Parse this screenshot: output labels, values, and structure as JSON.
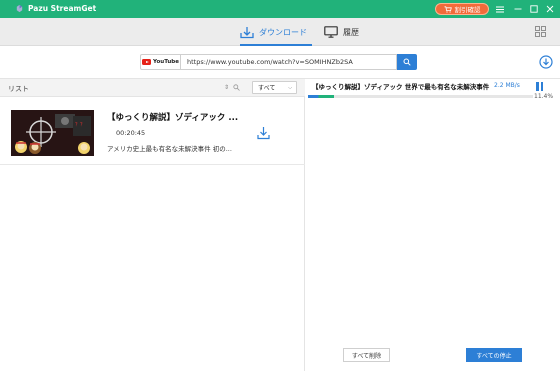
{
  "app": {
    "name": "Pazu StreamGet",
    "promo_label": "割引確認"
  },
  "tabs": {
    "download": "ダウンロード",
    "history": "履歴"
  },
  "url_bar": {
    "site": "YouTube",
    "value": "https://www.youtube.com/watch?v=SOMIHNZb2SA"
  },
  "list": {
    "title": "リスト",
    "filter": "すべて",
    "items": [
      {
        "title": "【ゆっくり解説】ゾディアック ...",
        "duration": "00:20:45",
        "description": "アメリカ史上最も有名な未解決事件 初の..."
      }
    ]
  },
  "task": {
    "title": "【ゆっくり解説】ゾディアック 世界で最も有名な未解決事件 1",
    "speed": "2.2 MB/s",
    "progress_percent": 11.4,
    "progress_label": "11.4%"
  },
  "buttons": {
    "delete_all": "すべて削除",
    "stop_all": "すべての停止"
  },
  "colors": {
    "brand": "#21b27a",
    "accent": "#2d7fd6",
    "promo": "#f26b3a"
  }
}
